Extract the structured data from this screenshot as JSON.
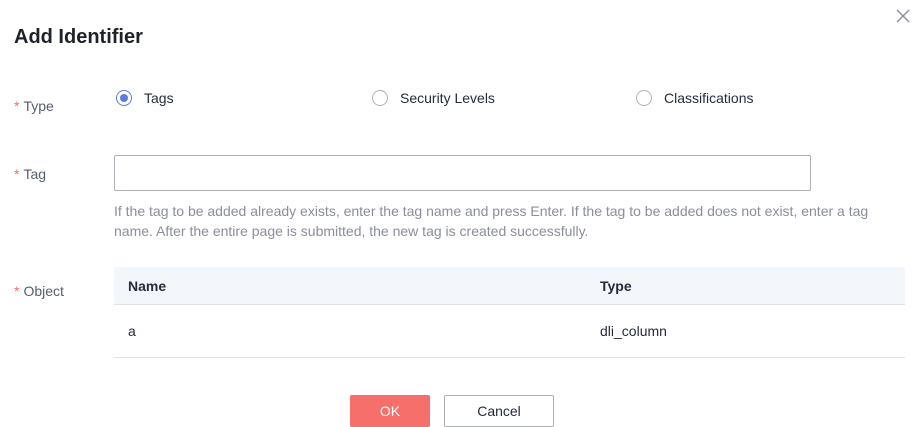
{
  "dialog": {
    "title": "Add Identifier",
    "close_icon": "close-icon"
  },
  "form": {
    "required_mark": "*",
    "type": {
      "label": "Type",
      "options": [
        {
          "label": "Tags",
          "checked": true
        },
        {
          "label": "Security Levels",
          "checked": false
        },
        {
          "label": "Classifications",
          "checked": false
        }
      ]
    },
    "tag": {
      "label": "Tag",
      "value": "",
      "placeholder": "",
      "help": "If the tag to be added already exists, enter the tag name and press Enter. If the tag to be added does not exist, enter a tag name. After the entire page is submitted, the new tag is created successfully."
    },
    "object": {
      "label": "Object",
      "columns": [
        "Name",
        "Type"
      ],
      "rows": [
        [
          "a",
          "dli_column"
        ]
      ]
    }
  },
  "footer": {
    "ok_label": "OK",
    "cancel_label": "Cancel"
  },
  "colors": {
    "accent": "#5e7ce0",
    "danger": "#f66f6a",
    "required": "#f66f6a"
  }
}
